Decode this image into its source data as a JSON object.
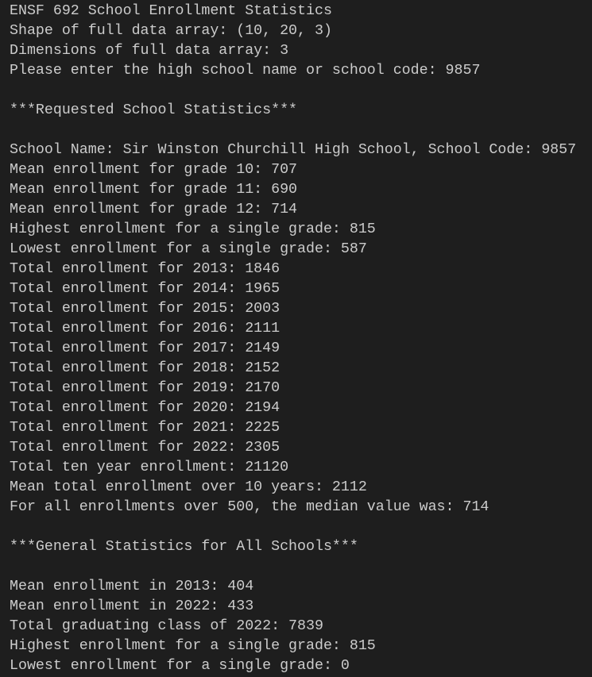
{
  "terminal": {
    "lines": [
      "ENSF 692 School Enrollment Statistics",
      "Shape of full data array: (10, 20, 3)",
      "Dimensions of full data array: 3",
      "Please enter the high school name or school code: 9857",
      "",
      "***Requested School Statistics***",
      "",
      "School Name: Sir Winston Churchill High School, School Code: 9857",
      "Mean enrollment for grade 10: 707",
      "Mean enrollment for grade 11: 690",
      "Mean enrollment for grade 12: 714",
      "Highest enrollment for a single grade: 815",
      "Lowest enrollment for a single grade: 587",
      "Total enrollment for 2013: 1846",
      "Total enrollment for 2014: 1965",
      "Total enrollment for 2015: 2003",
      "Total enrollment for 2016: 2111",
      "Total enrollment for 2017: 2149",
      "Total enrollment for 2018: 2152",
      "Total enrollment for 2019: 2170",
      "Total enrollment for 2020: 2194",
      "Total enrollment for 2021: 2225",
      "Total enrollment for 2022: 2305",
      "Total ten year enrollment: 21120",
      "Mean total enrollment over 10 years: 2112",
      "For all enrollments over 500, the median value was: 714",
      "",
      "***General Statistics for All Schools***",
      "",
      "Mean enrollment in 2013: 404",
      "Mean enrollment in 2022: 433",
      "Total graduating class of 2022: 7839",
      "Highest enrollment for a single grade: 815",
      "Lowest enrollment for a single grade: 0"
    ]
  }
}
